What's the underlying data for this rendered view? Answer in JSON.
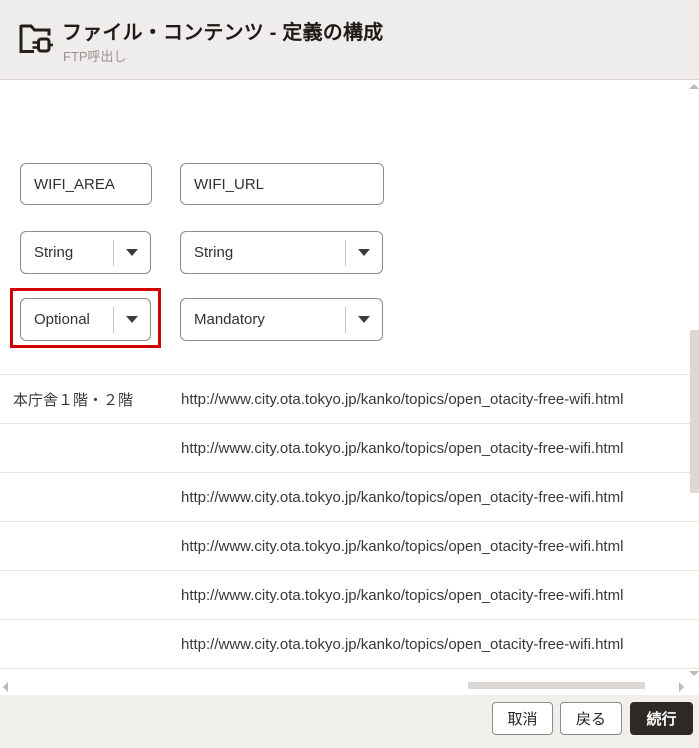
{
  "header": {
    "title": "ファイル・コンテンツ - 定義の構成",
    "subtitle": "FTP呼出し",
    "icon": "folder-plug-icon"
  },
  "form": {
    "element_names": [
      {
        "value": "WIFI_AREA"
      },
      {
        "value": "WIFI_URL"
      }
    ],
    "data_types": [
      {
        "value": "String"
      },
      {
        "value": "String"
      }
    ],
    "requirements": [
      {
        "value": "Optional",
        "highlighted": true
      },
      {
        "value": "Mandatory",
        "highlighted": false
      }
    ]
  },
  "sample_table": {
    "rows": [
      {
        "area": "本庁舎１階・２階",
        "url": "http://www.city.ota.tokyo.jp/kanko/topics/open_otacity-free-wifi.html"
      },
      {
        "area": "",
        "url": "http://www.city.ota.tokyo.jp/kanko/topics/open_otacity-free-wifi.html"
      },
      {
        "area": "",
        "url": "http://www.city.ota.tokyo.jp/kanko/topics/open_otacity-free-wifi.html"
      },
      {
        "area": "",
        "url": "http://www.city.ota.tokyo.jp/kanko/topics/open_otacity-free-wifi.html"
      },
      {
        "area": "",
        "url": "http://www.city.ota.tokyo.jp/kanko/topics/open_otacity-free-wifi.html"
      },
      {
        "area": "",
        "url": "http://www.city.ota.tokyo.jp/kanko/topics/open_otacity-free-wifi.html"
      }
    ]
  },
  "footer": {
    "buttons": [
      {
        "label": "取消",
        "variant": "secondary"
      },
      {
        "label": "戻る",
        "variant": "secondary"
      },
      {
        "label": "続行",
        "variant": "primary"
      }
    ]
  },
  "colors": {
    "highlight_red": "#d40000",
    "header_bg": "#efedeb",
    "footer_bg": "#f1efec",
    "primary_button_bg": "#2d2a26"
  }
}
